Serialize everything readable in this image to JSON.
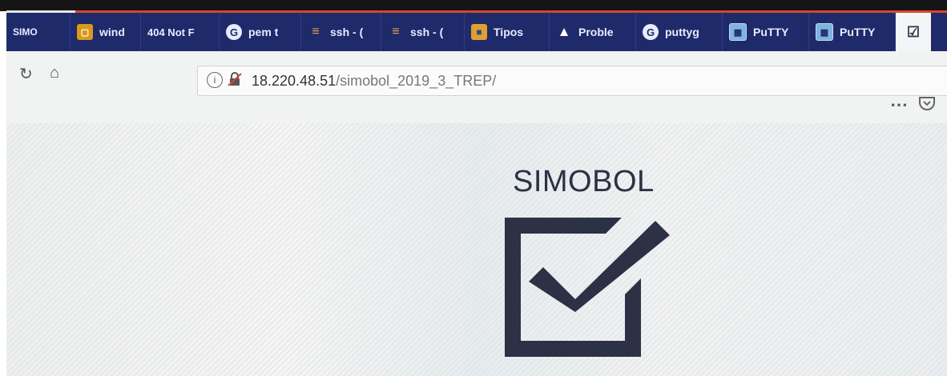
{
  "browser": {
    "tabs": [
      {
        "label": "SIMO",
        "icon": "none",
        "active": false
      },
      {
        "label": "wind",
        "icon": "window-icon",
        "active": false
      },
      {
        "label": "404 Not F",
        "icon": "none",
        "active": false
      },
      {
        "label": "pem t",
        "icon": "google-icon",
        "active": false
      },
      {
        "label": "ssh - (",
        "icon": "stackoverflow-icon",
        "active": false
      },
      {
        "label": "ssh - (",
        "icon": "stackoverflow-icon",
        "active": false
      },
      {
        "label": "Tipos",
        "icon": "box-icon",
        "active": false
      },
      {
        "label": "Proble",
        "icon": "warning-icon",
        "active": false
      },
      {
        "label": "puttyg",
        "icon": "google-icon",
        "active": false
      },
      {
        "label": "PuTTY",
        "icon": "putty-icon",
        "active": false
      },
      {
        "label": "PuTTY",
        "icon": "putty-icon",
        "active": false
      },
      {
        "label": "",
        "icon": "checkbox-icon",
        "active": true
      }
    ],
    "address_bar": {
      "host": "18.220.48.51",
      "path": "/simobol_2019_3_TREP/"
    },
    "colors": {
      "tabstrip": "#1f2a6b",
      "accent": "#d9452f"
    }
  },
  "page": {
    "logo_text": "SIMOBOL",
    "logo_color": "#2c3145"
  }
}
